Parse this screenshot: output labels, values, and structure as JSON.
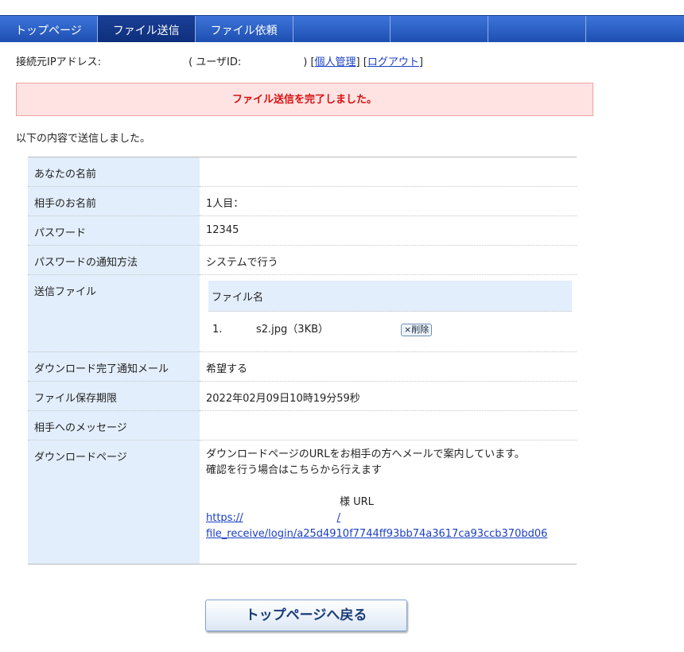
{
  "nav": {
    "tabs": [
      {
        "label": "トップページ"
      },
      {
        "label": "ファイル送信"
      },
      {
        "label": "ファイル依頼"
      },
      {
        "label": ""
      },
      {
        "label": ""
      },
      {
        "label": ""
      },
      {
        "label": ""
      }
    ]
  },
  "info": {
    "ip_label": "接続元IPアドレス:",
    "user_open": "( ユーザID:",
    "user_close": ")",
    "manage_link": "個人管理",
    "logout_link": "ログアウト"
  },
  "alert": {
    "message": "ファイル送信を完了しました。"
  },
  "lead": "以下の内容で送信しました。",
  "rows": {
    "sender_name": {
      "label": "あなたの名前",
      "value": ""
    },
    "recipient_name": {
      "label": "相手のお名前",
      "value": "1人目："
    },
    "password": {
      "label": "パスワード",
      "value": "12345"
    },
    "notify_method": {
      "label": "パスワードの通知方法",
      "value": "システムで行う"
    },
    "files": {
      "label": "送信ファイル",
      "header": "ファイル名",
      "items": [
        {
          "index": "1.",
          "name": "s2.jpg（3KB）",
          "delete_label": "×削除"
        }
      ]
    },
    "complete_mail": {
      "label": "ダウンロード完了通知メール",
      "value": "希望する"
    },
    "expire": {
      "label": "ファイル保存期限",
      "value": "2022年02月09日10時19分59秒"
    },
    "message": {
      "label": "相手へのメッセージ",
      "value": ""
    },
    "download_page": {
      "label": "ダウンロードページ",
      "line1": "ダウンロードページのURLをお相手の方へメールで案内しています。",
      "line2": "確認を行う場合はこちらから行えます",
      "recipient_suffix": "様 URL",
      "url_part1": "https://",
      "url_part1b": "/",
      "url_part2": "file_receive/login/a25d4910f7744ff93bb74a3617ca93ccb370bd06"
    }
  },
  "back_button": "トップページへ戻る"
}
